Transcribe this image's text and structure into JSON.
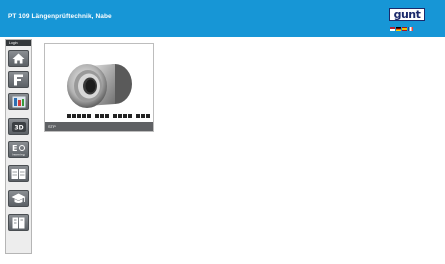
{
  "header": {
    "title": "PT 109 Längenprüftechnik, Nabe",
    "logo_text": "gunt",
    "background": "#1796d6"
  },
  "flags": [
    "#b22234",
    "#000000",
    "#ffcc00",
    "#0055a4"
  ],
  "sidebar": {
    "heading": "Login",
    "items": [
      {
        "icon": "home-icon"
      },
      {
        "icon": "caliper-icon"
      },
      {
        "icon": "measurement-panel-icon"
      },
      {
        "icon": "3d-icon",
        "label": "3D"
      },
      {
        "icon": "elearning-icon",
        "label": "E learning"
      },
      {
        "icon": "book-icon"
      },
      {
        "icon": "graduation-cap-icon"
      },
      {
        "icon": "documents-icon"
      }
    ]
  },
  "card": {
    "label": "STP",
    "image": "hub-part-render"
  }
}
